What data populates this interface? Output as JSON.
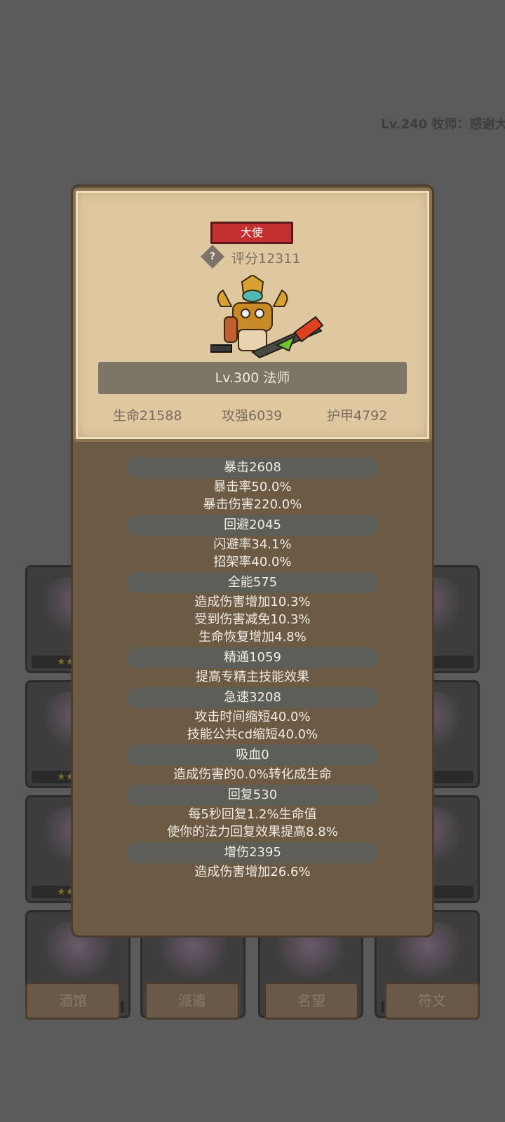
{
  "background": {
    "player_info": "Lv.240 牧师：感谢大",
    "plaques": [
      "酒馆",
      "派遣",
      "名望",
      "符文"
    ]
  },
  "hero": {
    "rank_badge": "大使",
    "score": "评分12311",
    "level_class": "Lv.300 法师",
    "basic_stats": [
      "生命21588",
      "攻强6039",
      "护甲4792"
    ]
  },
  "stats": [
    {
      "header": "暴击2608",
      "lines": [
        "暴击率50.0%",
        "暴击伤害220.0%"
      ]
    },
    {
      "header": "回避2045",
      "lines": [
        "闪避率34.1%",
        "招架率40.0%"
      ]
    },
    {
      "header": "全能575",
      "lines": [
        "造成伤害增加10.3%",
        "受到伤害减免10.3%",
        "生命恢复增加4.8%"
      ]
    },
    {
      "header": "精通1059",
      "lines": [
        "提高专精主技能效果"
      ]
    },
    {
      "header": "急速3208",
      "lines": [
        "攻击时间缩短40.0%",
        "技能公共cd缩短40.0%"
      ]
    },
    {
      "header": "吸血0",
      "lines": [
        "造成伤害的0.0%转化成生命"
      ]
    },
    {
      "header": "回复530",
      "lines": [
        "每5秒回复1.2%生命值",
        "使你的法力回复效果提高8.8%"
      ]
    },
    {
      "header": "增伤2395",
      "lines": [
        "造成伤害增加26.6%"
      ]
    }
  ],
  "colors": {
    "overlay": "#5a5a5a",
    "popup_brown": "#6c5a44",
    "parchment": "#dfc8a0",
    "rank_red": "#c43030",
    "stat_pill": "#5e5e58"
  }
}
